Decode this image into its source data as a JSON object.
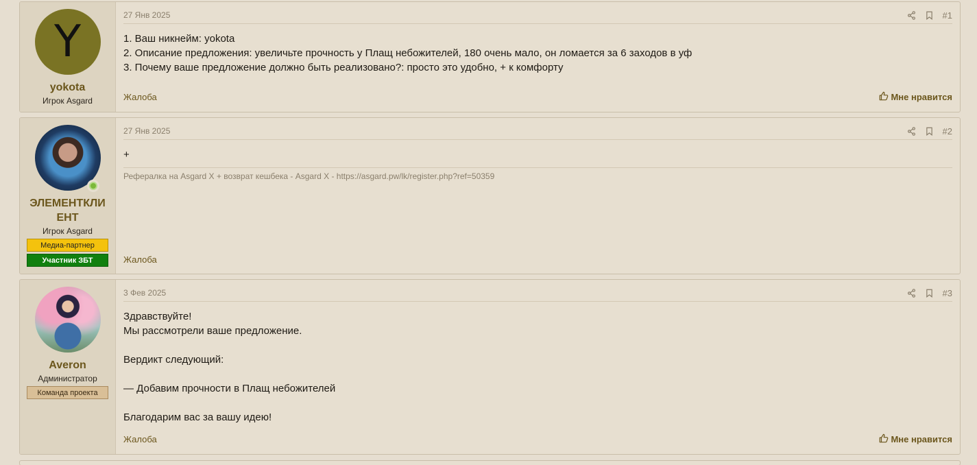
{
  "posts": [
    {
      "avatar_letter": "Y",
      "username": "yokota",
      "user_title": "Игрок Asgard",
      "date": "27 Янв 2025",
      "number": "#1",
      "message": [
        "1. Ваш никнейм: yokota",
        "2. Описание предложения: увеличьте прочность у Плащ небожителей, 180 очень мало, он ломается за 6 заходов в уф",
        "3. Почему ваше предложение должно быть реализовано?: просто это удобно, + к комфорту"
      ],
      "report_label": "Жалоба",
      "like_label": "Мне нравится"
    },
    {
      "username": "ЭЛЕМЕНТКЛИЕНТ",
      "user_title": "Игрок Asgard",
      "banners": [
        "Медиа-партнер",
        "Участник ЗБТ"
      ],
      "date": "27 Янв 2025",
      "number": "#2",
      "message": [
        "+"
      ],
      "signature": "Рефералка на Asgard X + возврат кешбека - Asgard X - https://asgard.pw/lk/register.php?ref=50359",
      "report_label": "Жалоба"
    },
    {
      "username": "Averon",
      "user_title": "Администратор",
      "banners": [
        "Команда проекта"
      ],
      "date": "3 Фев 2025",
      "number": "#3",
      "message": [
        "Здравствуйте!",
        "Мы рассмотрели ваше предложение.",
        "",
        "Вердикт следующий:",
        "",
        "— Добавим прочности в Плащ небожителей",
        "",
        "Благодарим вас за вашу идею!"
      ],
      "report_label": "Жалоба",
      "like_label": "Мне нравится"
    }
  ],
  "colors": {
    "background": "#e6ded0",
    "user_cell": "#ddd4c1",
    "username": "#6b561c",
    "muted": "#8a7f6c",
    "banner_gold": "#f4c20d",
    "banner_green": "#11800f",
    "banner_tan": "#d9bf97",
    "online": "#7cb83a"
  }
}
